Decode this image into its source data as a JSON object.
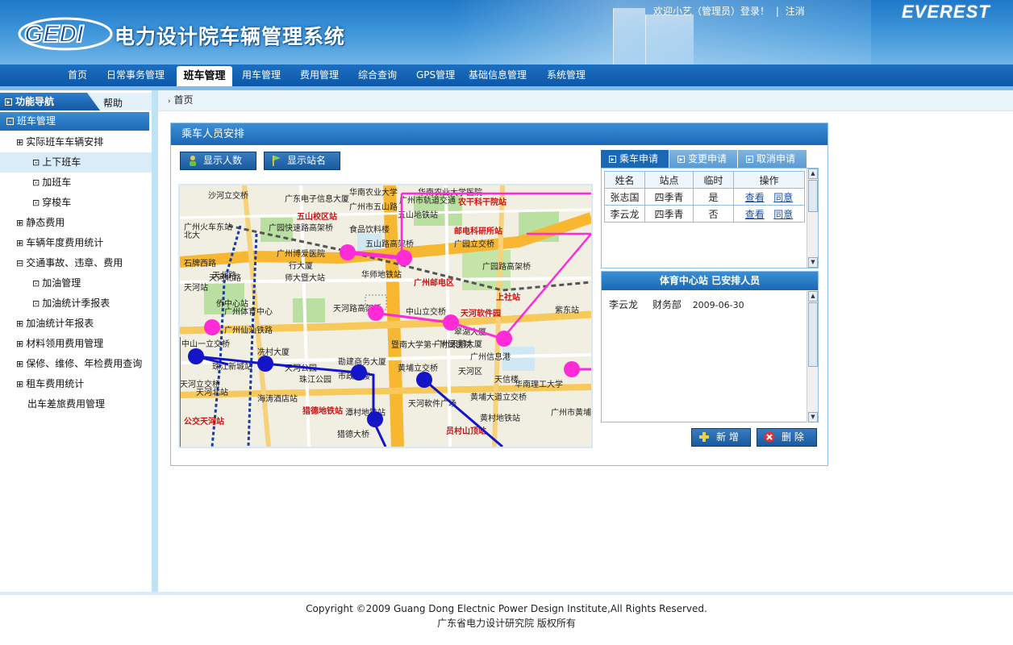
{
  "header": {
    "logo_text": "GEDI",
    "system_title": "电力设计院车辆管理系统",
    "welcome": "欢迎小艺（管理员）登录！",
    "separator": "|",
    "logout": "注消",
    "brand": "EVEREST"
  },
  "nav": {
    "items": [
      "首页",
      "日常事务管理",
      "班车管理",
      "用车管理",
      "费用管理",
      "综合查询",
      "GPS管理",
      "基础信息管理",
      "系统管理"
    ],
    "active": "班车管理"
  },
  "sidebar": {
    "tab_label": "功能导航",
    "help_label": "帮助",
    "group_label": "班车管理",
    "items": [
      {
        "label": "实际班车车辆安排",
        "marker": "⊞"
      },
      {
        "label": "上下班车",
        "marker": "⊡"
      },
      {
        "label": "加班车",
        "marker": "⊡"
      },
      {
        "label": "穿梭车",
        "marker": "⊡"
      },
      {
        "label": "静态费用",
        "marker": "⊞"
      },
      {
        "label": "车辆年度费用统计",
        "marker": "⊞"
      },
      {
        "label": "交通事故、违章、费用",
        "marker": "⊟"
      },
      {
        "label": "加油管理",
        "marker": "⊡"
      },
      {
        "label": "加油统计季报表",
        "marker": "⊡"
      },
      {
        "label": "加油统计年报表",
        "marker": "⊞"
      },
      {
        "label": "材料领用费用管理",
        "marker": "⊞"
      },
      {
        "label": "保修、维修、年检费用查询",
        "marker": "⊞"
      },
      {
        "label": "租车费用统计",
        "marker": "⊞"
      },
      {
        "label": "出车差旅费用管理",
        "marker": ""
      }
    ]
  },
  "breadcrumb": "首页",
  "panel": {
    "title": "乘车人员安排",
    "show_count_btn": "显示人数",
    "show_station_btn": "显示站名"
  },
  "map": {
    "labels": [
      "沙河立交桥",
      "广东电子信息大厦",
      "华南农业大学",
      "华南农业大学医院",
      "广州火车东站",
      "五山校区站",
      "广州市轨道交通",
      "五山地铁站",
      "农干科干院站",
      "邮电科研所站",
      "广园快速路高架桥",
      "五山路高架桥",
      "广园立交桥",
      "广园路高架桥",
      "广州博爱医院",
      "行大厦",
      "华师地铁站",
      "广州邮电区",
      "师大暨大站",
      "天河北路",
      "天河路高架桥",
      "中山立交桥",
      "天河软件园",
      "上社站",
      "紫东站",
      "广州仙汕铁路",
      "石牌西路",
      "华南理工大学",
      "翠湖大厦",
      "暨南大学第一附属医院",
      "广州信息港",
      "中山一立交桥",
      "冼村大厦",
      "勘建商务大厦",
      "广州体育中心",
      "珠江新城站",
      "猎德地铁站",
      "海涛酒店站",
      "黄埔立交桥",
      "天河区",
      "天信楼",
      "黄埔大道立交桥",
      "天河軟件广场",
      "黄村地铁站",
      "员村山顶站",
      "公交天河站",
      "天河立交桥",
      "市政大楼",
      "珠江公园",
      "潭村地铁站",
      "猎德大桥",
      "广州市黄埔工",
      "食品饮料楼",
      "广州市五山路",
      "北大",
      "天北路",
      "天河北站",
      "侨中心站",
      "广州天鹅大厦",
      "天河站",
      "天河公园"
    ]
  },
  "right_tabs": [
    "乘车申请",
    "变更申请",
    "取消申请"
  ],
  "grid": {
    "headers": [
      "姓名",
      "站点",
      "临时",
      "操作"
    ],
    "rows": [
      {
        "name": "张志国",
        "station": "四季青",
        "temp": "是",
        "view": "查看",
        "agree": "同意"
      },
      {
        "name": "李云龙",
        "station": "四季青",
        "temp": "否",
        "view": "查看",
        "agree": "同意"
      }
    ]
  },
  "section": {
    "title": "体育中心站 已安排人员",
    "rows": [
      {
        "name": "李云龙",
        "dept": "财务部",
        "date": "2009-06-30"
      }
    ]
  },
  "actions": {
    "add": "新 增",
    "delete": "删 除"
  },
  "footer": {
    "copyright": "Copyright ©2009 Guang Dong Electnic Power Design Institute,All Rights Reserved.",
    "org": "广东省电力设计研究院 版权所有"
  }
}
